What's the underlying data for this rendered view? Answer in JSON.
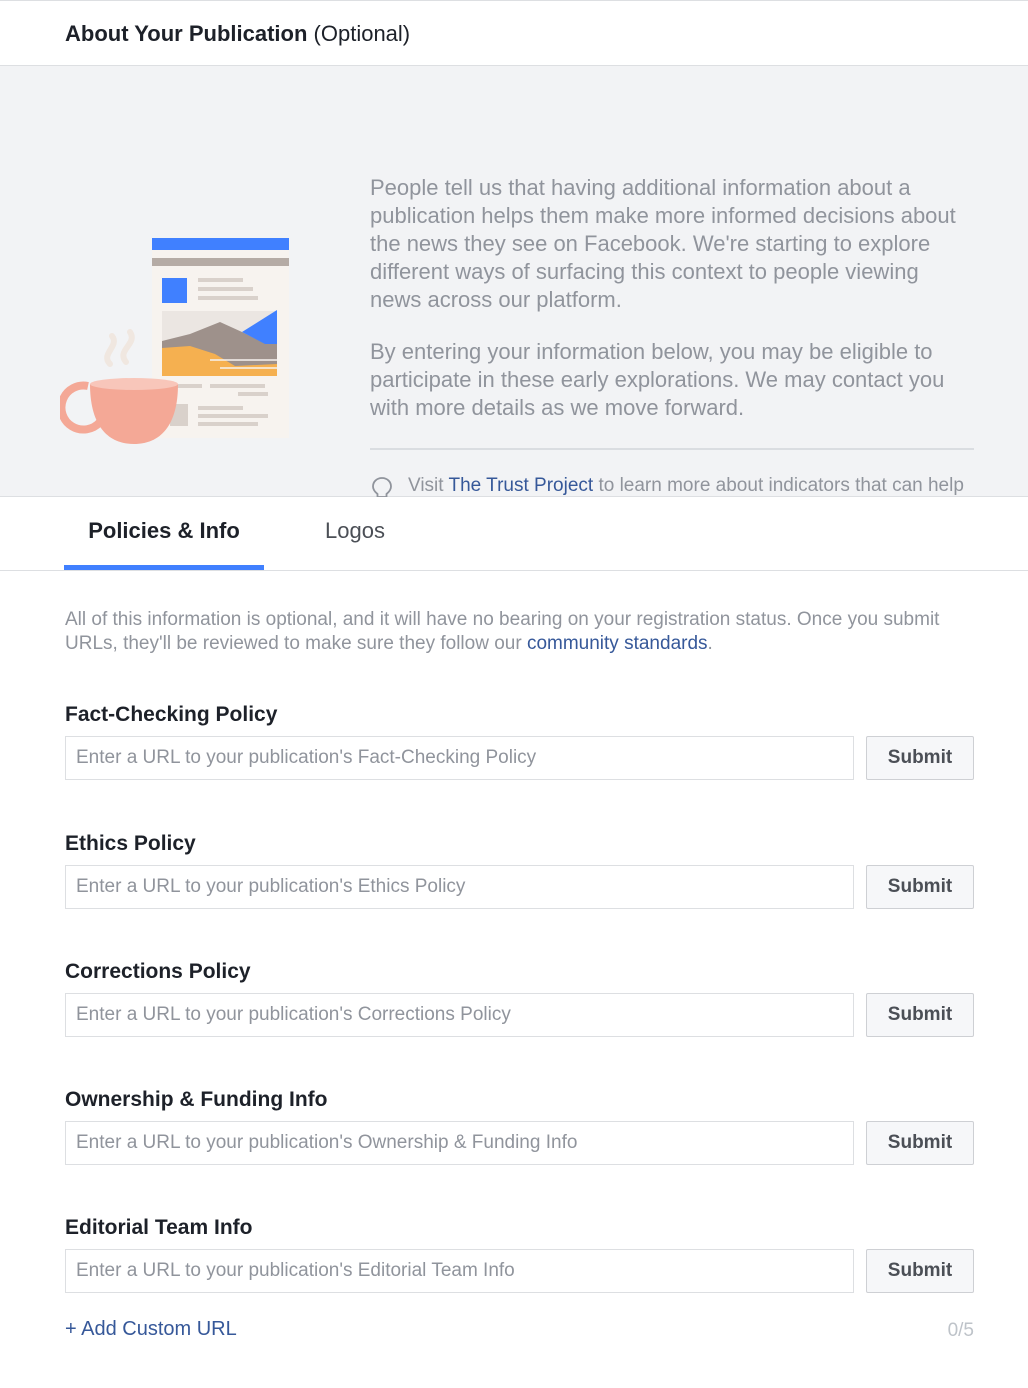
{
  "header": {
    "title_bold": "About Your Publication",
    "title_optional": "(Optional)"
  },
  "intro": {
    "paragraph1": "People tell us that having additional information about a publication helps them make more informed decisions about the news they see on Facebook. We're starting to explore different ways of surfacing this context to people viewing news across our platform.",
    "paragraph2": "By entering your information below, you may be eligible to participate in these early explorations. We may contact you with more details as we move forward.",
    "tip": {
      "prefix": "Visit",
      "link": "The Trust Project",
      "suffix": "to learn more about indicators that can help build trust with your audience."
    }
  },
  "tabs": [
    {
      "label": "Policies & Info",
      "active": true
    },
    {
      "label": "Logos",
      "active": false
    }
  ],
  "notice": {
    "text": "All of this information is optional, and it will have no bearing on your registration status. Once you submit URLs, they'll be reviewed to make sure they follow our",
    "link": "community standards",
    "end": "."
  },
  "fields": [
    {
      "label": "Fact-Checking Policy",
      "placeholder": "Enter a URL to your publication's Fact-Checking Policy",
      "value": "",
      "button": "Submit"
    },
    {
      "label": "Ethics Policy",
      "placeholder": "Enter a URL to your publication's Ethics Policy",
      "value": "",
      "button": "Submit"
    },
    {
      "label": "Corrections Policy",
      "placeholder": "Enter a URL to your publication's Corrections Policy",
      "value": "",
      "button": "Submit"
    },
    {
      "label": "Ownership & Funding Info",
      "placeholder": "Enter a URL to your publication's Ownership & Funding Info",
      "value": "",
      "button": "Submit"
    },
    {
      "label": "Editorial Team Info",
      "placeholder": "Enter a URL to your publication's Editorial Team Info",
      "value": "",
      "button": "Submit"
    }
  ],
  "footer": {
    "add_custom_url": "+ Add Custom URL",
    "counter": "0/5"
  },
  "colors": {
    "accent": "#4080ff",
    "link": "#365899",
    "muted_text": "#90949c",
    "panel_bg": "#f2f3f5"
  },
  "icons": {
    "illustration": "newspaper-coffee-illustration",
    "tip": "lightbulb-icon"
  }
}
